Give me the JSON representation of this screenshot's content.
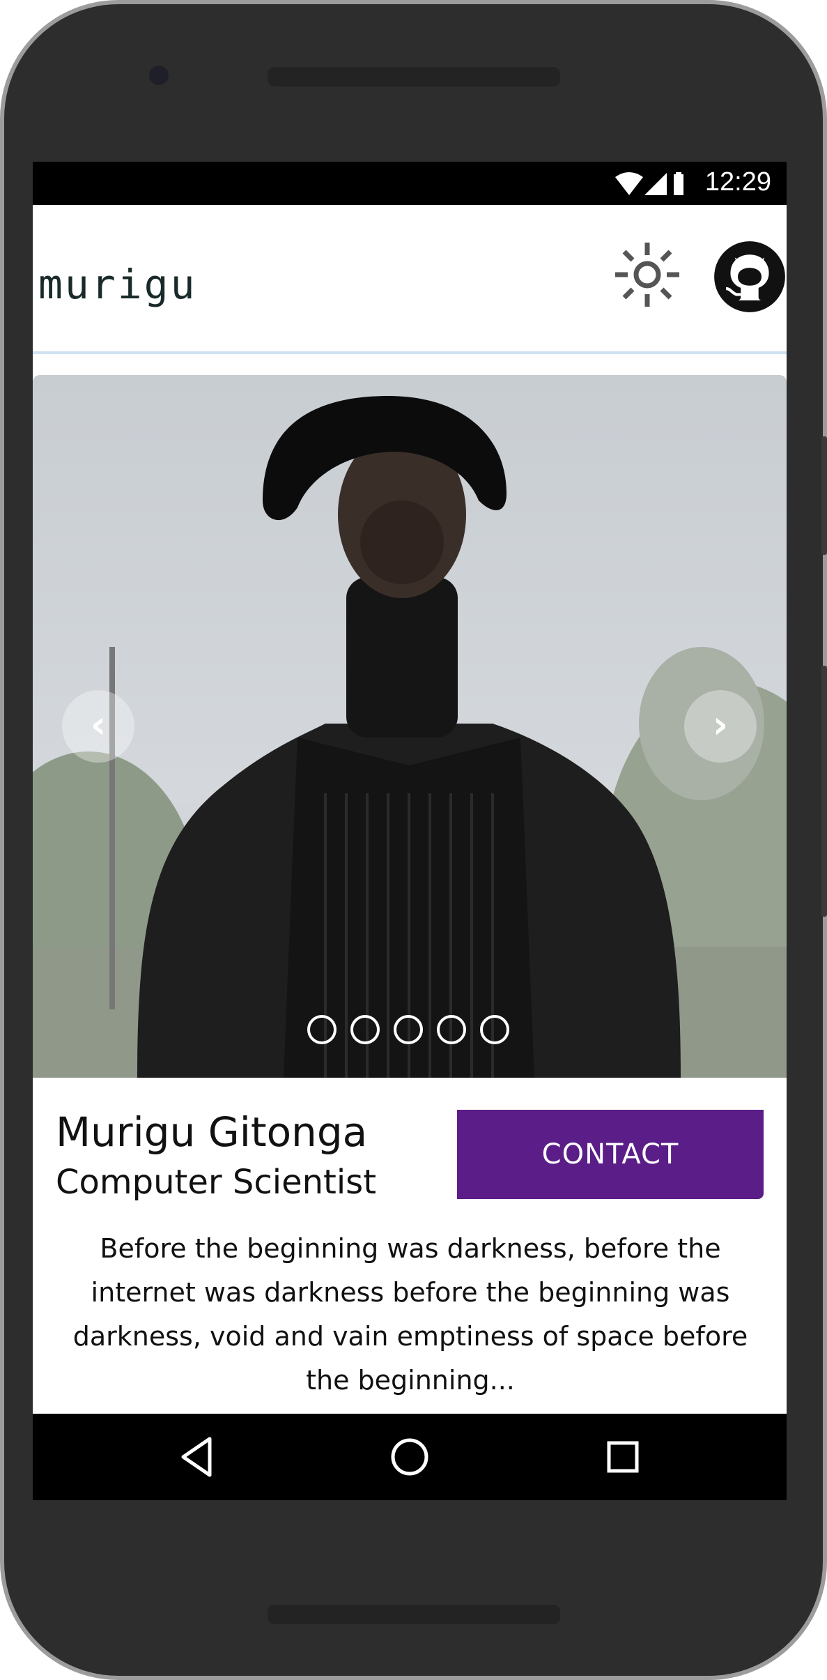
{
  "status_bar": {
    "time": "12:29",
    "icons": [
      "wifi-icon",
      "signal-icon",
      "battery-icon"
    ]
  },
  "header": {
    "logo_text": "murigu",
    "theme_icon": "sun-icon",
    "github_icon": "github-icon"
  },
  "carousel": {
    "prev_icon": "chevron-left-icon",
    "next_icon": "chevron-right-icon",
    "prev_label": "‹",
    "next_label": "›",
    "slide_count": 5,
    "image_description": "portrait-photo"
  },
  "profile": {
    "name": "Murigu Gitonga",
    "title": "Computer Scientist",
    "contact_label": "CONTACT",
    "bio": "Before the beginning was darkness, before the internet was darkness before the beginning was darkness, void and vain emptiness of space before the beginning..."
  },
  "nav": {
    "back_icon": "back-triangle-icon",
    "home_icon": "home-circle-icon",
    "recents_icon": "recents-square-icon"
  },
  "colors": {
    "accent": "#5b1d87",
    "status_bar_bg": "#000000",
    "frame": "#2d2d2d"
  }
}
